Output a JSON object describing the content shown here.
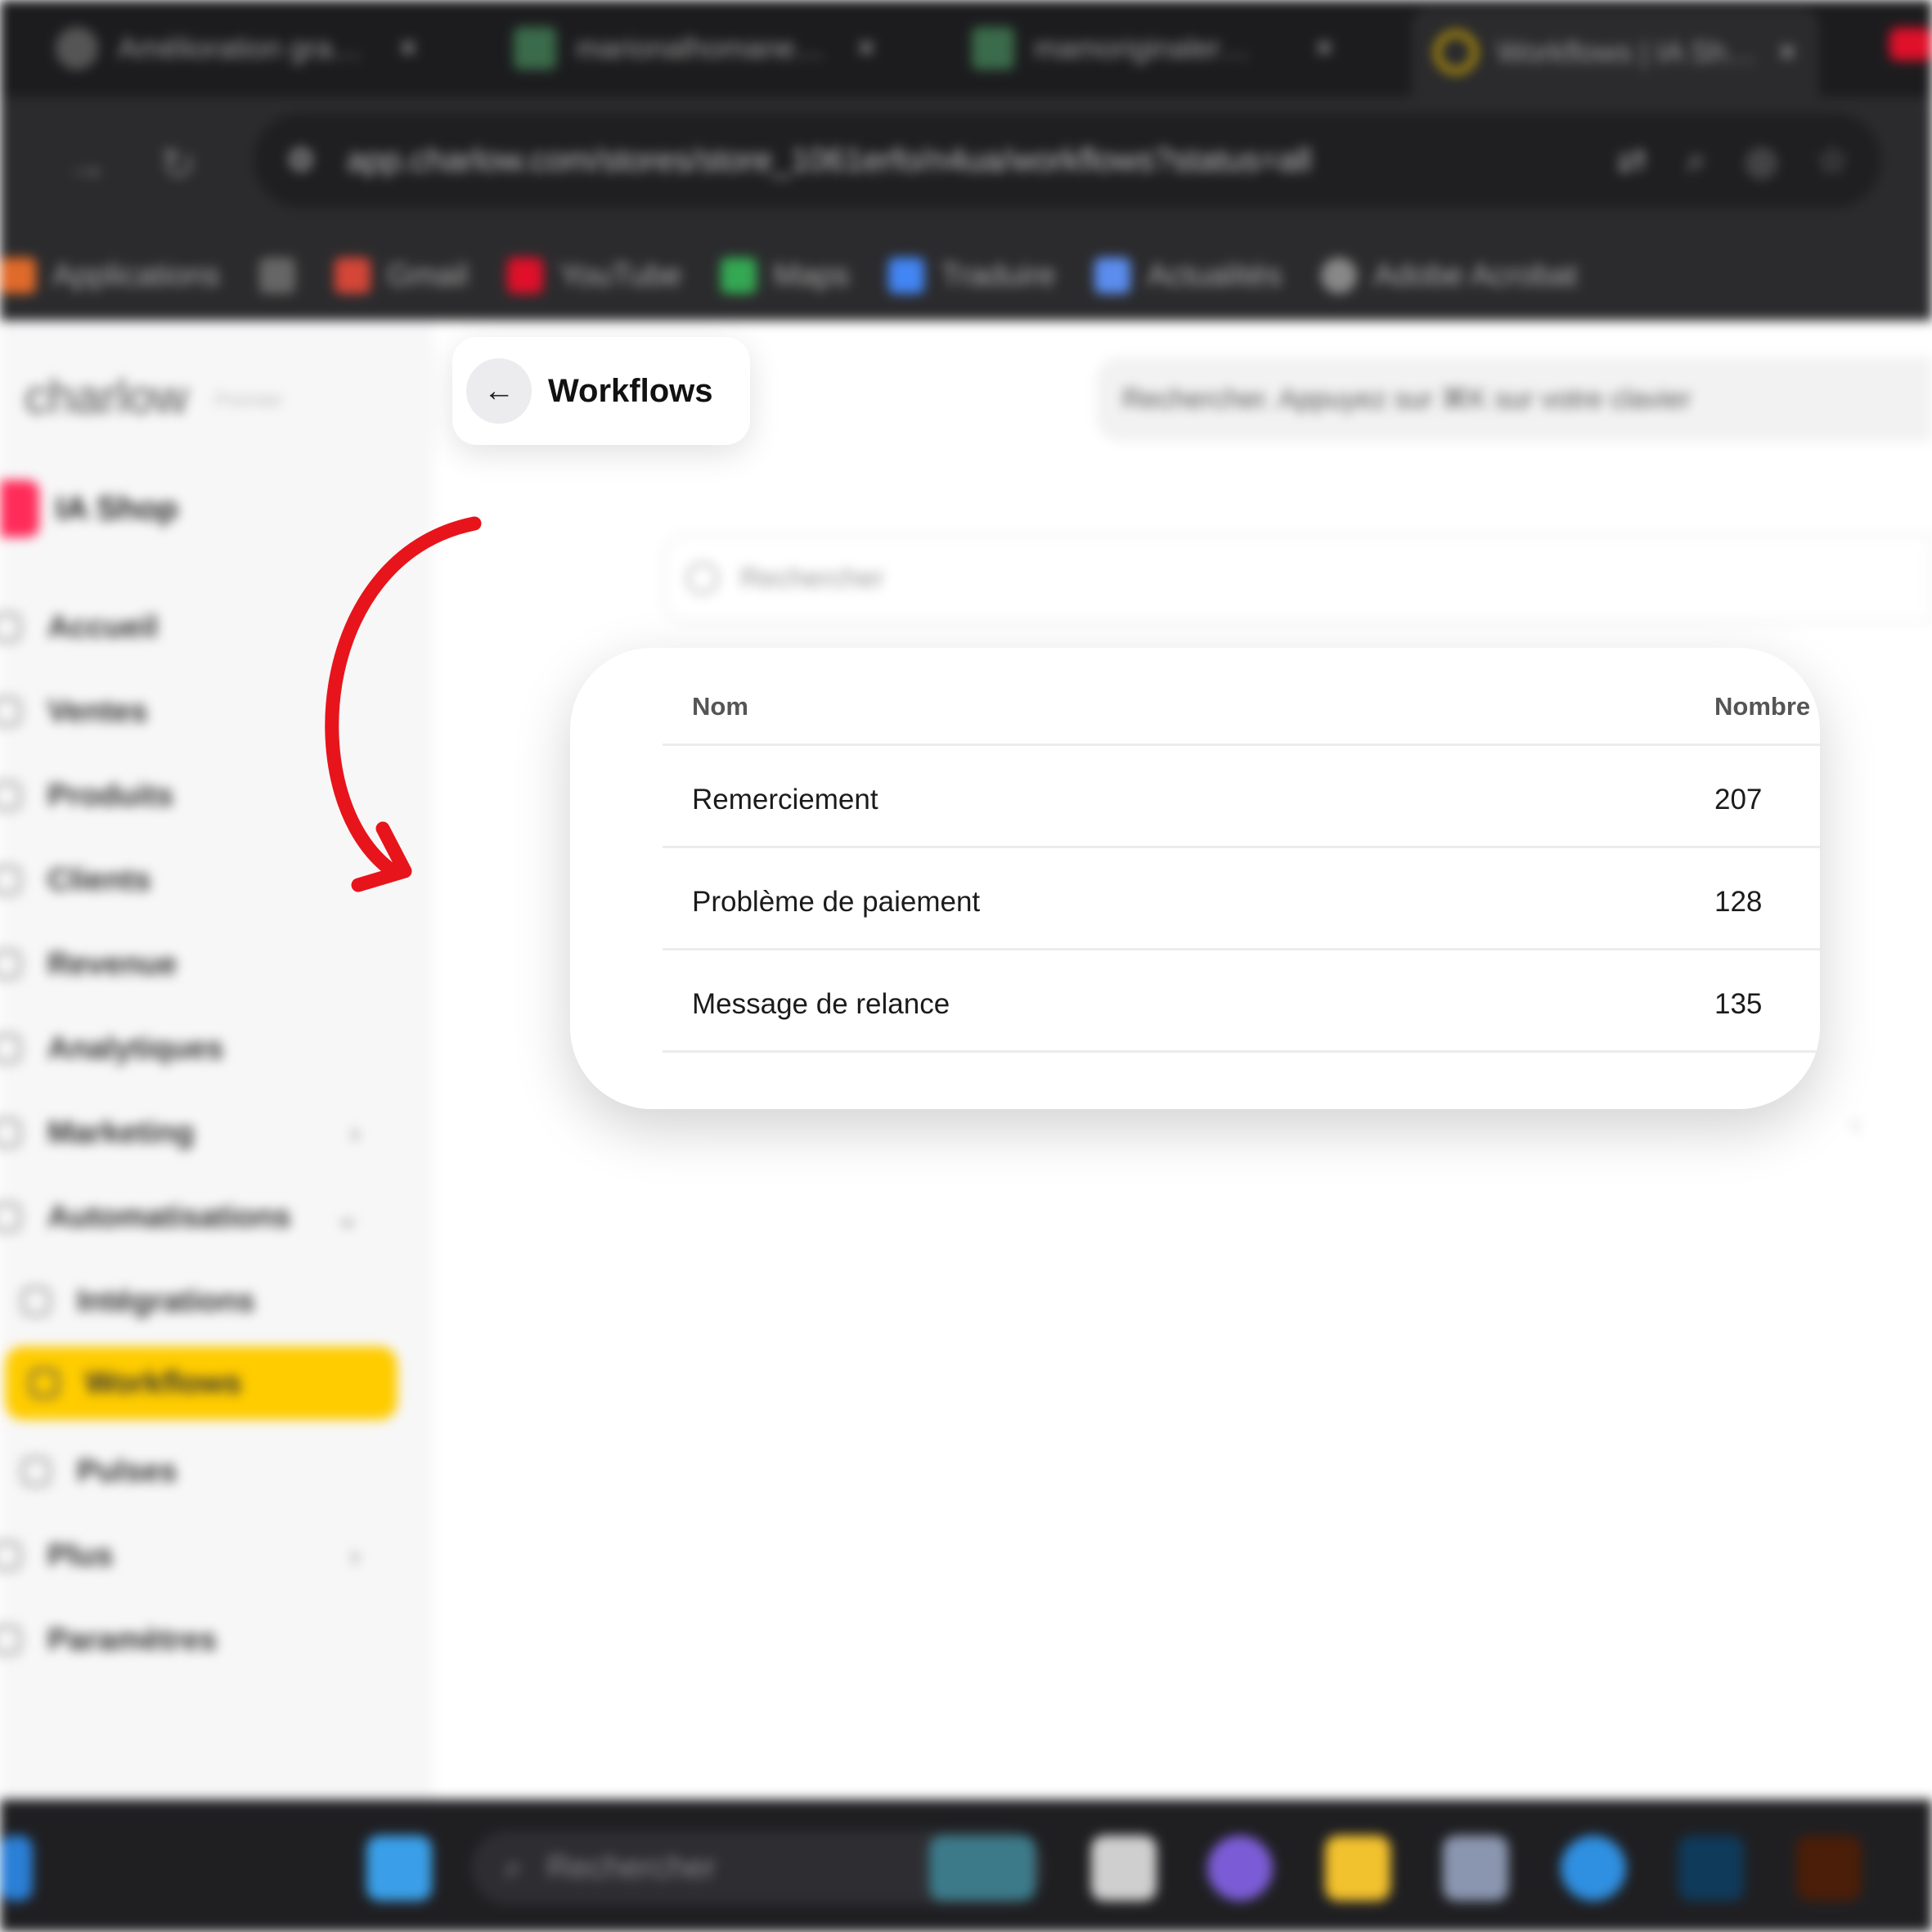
{
  "browser": {
    "tabs": [
      {
        "label": "Amélioration gra…",
        "icon": "gear-icon"
      },
      {
        "label": "marionalhomane…",
        "icon": "doc-icon"
      },
      {
        "label": "mamoriginaler…",
        "icon": "doc-icon"
      },
      {
        "label": "Workflows | IA Sh…",
        "icon": "loading-icon"
      }
    ],
    "close_symbol": "×",
    "url": "app.charlow.com/stores/store_1061erfo/n4ua/workflows?status=all",
    "bookmarks": [
      "Applications",
      "Gmail",
      "YouTube",
      "Maps",
      "Traduire",
      "Actualités",
      "Adobe Acrobat"
    ]
  },
  "app": {
    "brand": "charlow",
    "brand_sub": "Premier",
    "store_name": "IA Shop",
    "menu": [
      "Accueil",
      "Ventes",
      "Produits",
      "Clients",
      "Revenue",
      "Analytiques",
      "Marketing",
      "Automatisations",
      "Intégrations",
      "Workflows",
      "Pulses",
      "Plus",
      "Paramètres"
    ],
    "active_menu": "Workflows",
    "top_search_placeholder": "Rechercher. Appuyez sur ⌘K sur votre clavier",
    "list_search_placeholder": "Rechercher"
  },
  "header": {
    "back_symbol": "←",
    "title": "Workflows"
  },
  "table": {
    "columns": [
      "Nom",
      "Nombre d'exécutions"
    ],
    "rows": [
      {
        "name": "Remerciement",
        "count": "207"
      },
      {
        "name": "Problème de paiement",
        "count": "128"
      },
      {
        "name": "Message de relance",
        "count": "135"
      }
    ]
  },
  "taskbar": {
    "search_label": "Rechercher"
  },
  "colors": {
    "accent": "#ffcc00",
    "arrow": "#e8141b",
    "store_logo": "#ff2c5a"
  }
}
